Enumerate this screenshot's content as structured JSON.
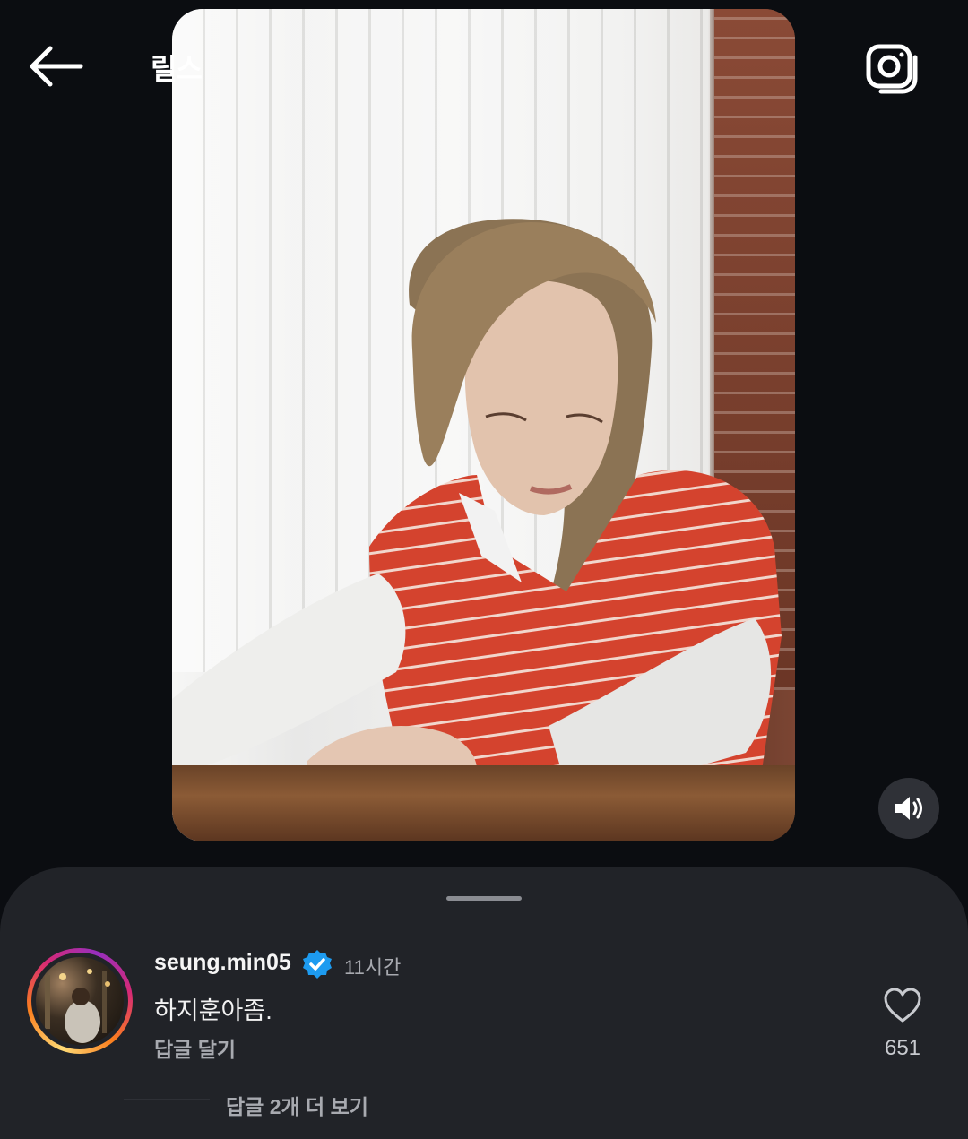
{
  "header": {
    "title": "릴스",
    "back_icon": "arrow-left-icon",
    "camera_icon": "camera-icon"
  },
  "video": {
    "sound_icon": "volume-icon"
  },
  "comment": {
    "username": "seung.min05",
    "verified": true,
    "time": "11시간",
    "text": "하지훈아좀.",
    "reply_label": "답글 달기",
    "like_count": "651",
    "more_replies_label": "답글 2개 더 보기"
  },
  "colors": {
    "background": "#0b0d11",
    "sheet": "#212328",
    "verified_blue": "#1d9bf0",
    "secondary_text": "#a8aab0"
  }
}
